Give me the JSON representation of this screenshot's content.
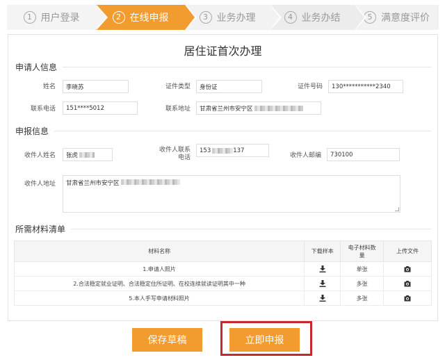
{
  "steps": [
    {
      "num": "1",
      "label": "用户登录"
    },
    {
      "num": "2",
      "label": "在线申报"
    },
    {
      "num": "3",
      "label": "业务办理"
    },
    {
      "num": "4",
      "label": "业务办结"
    },
    {
      "num": "5",
      "label": "满意度评价"
    }
  ],
  "form": {
    "title": "居住证首次办理",
    "applicant": {
      "section": "申请人信息",
      "name_label": "姓名",
      "name_value": "李晓苏",
      "id_type_label": "证件类型",
      "id_type_value": "身份证",
      "id_number_label": "证件号码",
      "id_number_value": "130***********2340",
      "phone_label": "联系电话",
      "phone_value": "151****5012",
      "address_label": "联系地址",
      "address_value": "甘肃省兰州市安宁区"
    },
    "report": {
      "section": "申报信息",
      "recipient_name_label": "收件人姓名",
      "recipient_name_value": "张虎",
      "recipient_phone_label": "收件人联系电话",
      "recipient_phone_value_a": "153",
      "recipient_phone_value_b": "137",
      "postcode_label": "收件人邮编",
      "postcode_value": "730100",
      "recipient_address_label": "收件人地址",
      "recipient_address_value": "甘肃省兰州市安宁区"
    },
    "materials": {
      "section": "所需材料清单",
      "headers": [
        "材料名称",
        "下载样本",
        "电子材料数量",
        "上传文件"
      ],
      "rows": [
        {
          "name": "1.申请人照片",
          "count": "单张"
        },
        {
          "name": "2.合法稳定就业证明、合法稳定住所证明、在校连续就读证明其中一种",
          "count": "多张"
        },
        {
          "name": "5.本人手写申请材料照片",
          "count": "多张"
        }
      ]
    }
  },
  "buttons": {
    "save": "保存草稿",
    "submit": "立即申报"
  },
  "colors": {
    "accent": "#f29b2f",
    "highlight": "#c8282d"
  }
}
